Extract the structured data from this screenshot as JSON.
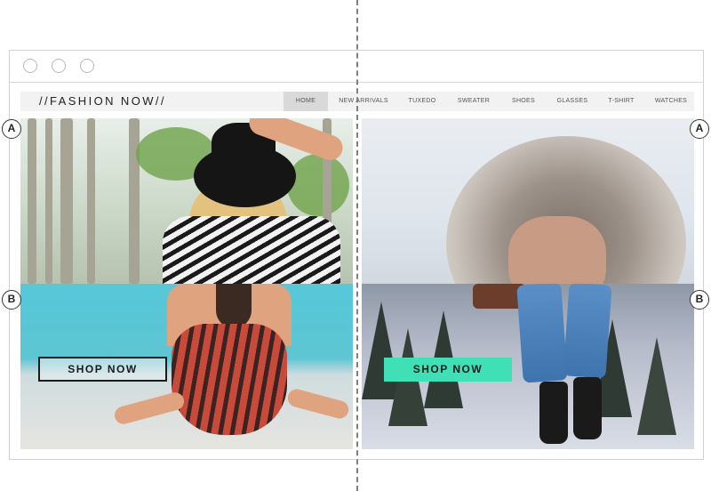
{
  "site": {
    "logo": "//FASHION NOW//",
    "nav": [
      "HOME",
      "NEW ARRIVALS",
      "TUXEDO",
      "SWEATER",
      "SHOES",
      "GLASSES",
      "T-SHIRT",
      "WATCHES"
    ],
    "active_nav": "HOME"
  },
  "left_panel": {
    "cta_label": "SHOP NOW",
    "cta_style": "outline"
  },
  "right_panel": {
    "cta_label": "SHOP NOW",
    "cta_style": "filled",
    "cta_color": "#3fe0b6"
  },
  "markers": {
    "top": "A",
    "bottom": "B"
  },
  "colors": {
    "nav_bg": "#f2f2f2",
    "nav_active_bg": "#d9d9d9",
    "accent": "#3fe0b6",
    "divider": "#7f7f7f"
  }
}
